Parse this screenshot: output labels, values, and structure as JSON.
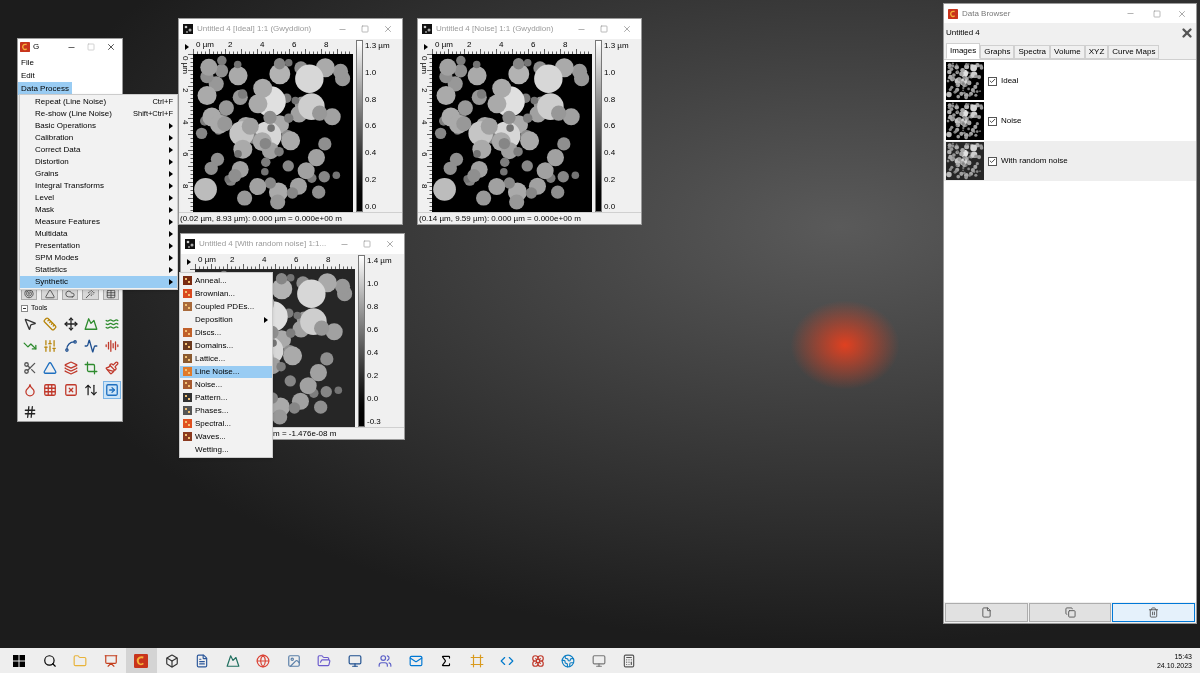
{
  "main_window": {
    "title": "G",
    "menu": [
      {
        "label": "File",
        "selected": false
      },
      {
        "label": "Edit",
        "selected": false
      },
      {
        "label": "Data Process",
        "selected": true
      }
    ],
    "toolbox_section": "Tools",
    "tools": [
      {
        "selected": false
      },
      {
        "selected": false
      },
      {
        "selected": false
      },
      {
        "selected": false
      },
      {
        "selected": false
      },
      {
        "selected": false
      },
      {
        "selected": false
      },
      {
        "selected": false
      },
      {
        "selected": false
      },
      {
        "selected": false
      },
      {
        "selected": false
      },
      {
        "selected": false
      },
      {
        "selected": false
      },
      {
        "selected": false
      },
      {
        "selected": false
      },
      {
        "selected": false
      },
      {
        "selected": false
      },
      {
        "selected": false
      },
      {
        "selected": false
      },
      {
        "selected": true
      },
      {
        "selected": false
      }
    ]
  },
  "data_process_menu": [
    {
      "label": "Repeat (Line Noise)",
      "shortcut": "Ctrl+F",
      "submenu": false,
      "selected": false
    },
    {
      "label": "Re-show (Line Noise)",
      "shortcut": "Shift+Ctrl+F",
      "submenu": false,
      "selected": false
    },
    {
      "label": "Basic Operations",
      "submenu": true,
      "selected": false
    },
    {
      "label": "Calibration",
      "submenu": true,
      "selected": false
    },
    {
      "label": "Correct Data",
      "submenu": true,
      "selected": false
    },
    {
      "label": "Distortion",
      "submenu": true,
      "selected": false
    },
    {
      "label": "Grains",
      "submenu": true,
      "selected": false
    },
    {
      "label": "Integral Transforms",
      "submenu": true,
      "selected": false
    },
    {
      "label": "Level",
      "submenu": true,
      "selected": false
    },
    {
      "label": "Mask",
      "submenu": true,
      "selected": false
    },
    {
      "label": "Measure Features",
      "submenu": true,
      "selected": false
    },
    {
      "label": "Multidata",
      "submenu": true,
      "selected": false
    },
    {
      "label": "Presentation",
      "submenu": true,
      "selected": false
    },
    {
      "label": "SPM Modes",
      "submenu": true,
      "selected": false
    },
    {
      "label": "Statistics",
      "submenu": true,
      "selected": false
    },
    {
      "label": "Synthetic",
      "submenu": true,
      "selected": true
    }
  ],
  "synthetic_menu": [
    {
      "label": "Anneal...",
      "submenu": false,
      "selected": false
    },
    {
      "label": "Brownian...",
      "submenu": false,
      "selected": false
    },
    {
      "label": "Coupled PDEs...",
      "submenu": false,
      "selected": false
    },
    {
      "label": "Deposition",
      "submenu": true,
      "selected": false
    },
    {
      "label": "Discs...",
      "submenu": false,
      "selected": false
    },
    {
      "label": "Domains...",
      "submenu": false,
      "selected": false
    },
    {
      "label": "Lattice...",
      "submenu": false,
      "selected": false
    },
    {
      "label": "Line Noise...",
      "submenu": false,
      "selected": true
    },
    {
      "label": "Noise...",
      "submenu": false,
      "selected": false
    },
    {
      "label": "Pattern...",
      "submenu": false,
      "selected": false
    },
    {
      "label": "Phases...",
      "submenu": false,
      "selected": false
    },
    {
      "label": "Spectral...",
      "submenu": false,
      "selected": false
    },
    {
      "label": "Waves...",
      "submenu": false,
      "selected": false
    },
    {
      "label": "Wetting...",
      "submenu": false,
      "selected": false
    }
  ],
  "image_windows": [
    {
      "title": "Untitled 4 [Ideal] 1:1 (Gwyddion)",
      "top_ruler": [
        "0 µm",
        "2",
        "4",
        "6",
        "8"
      ],
      "left_ruler": [
        "0 µm",
        "2",
        "4",
        "6",
        "8"
      ],
      "scale": [
        "1.3 µm",
        "1.0",
        "0.8",
        "0.6",
        "0.4",
        "0.2",
        "0.0"
      ],
      "status": "(0.02 µm, 8.93 µm): 0.000 µm = 0.000e+00 m",
      "noisy": false
    },
    {
      "title": "Untitled 4 [Noise] 1:1 (Gwyddion)",
      "top_ruler": [
        "0 µm",
        "2",
        "4",
        "6",
        "8"
      ],
      "left_ruler": [
        "0 µm",
        "2",
        "4",
        "6",
        "8"
      ],
      "scale": [
        "1.3 µm",
        "1.0",
        "0.8",
        "0.6",
        "0.4",
        "0.2",
        "0.0"
      ],
      "status": "(0.14 µm, 9.59 µm): 0.000 µm = 0.000e+00 m",
      "noisy": false
    },
    {
      "title": "Untitled 4 [With random noise] 1:1...",
      "top_ruler": [
        "0 µm",
        "2",
        "4",
        "6",
        "8"
      ],
      "scale": [
        "1.4 µm",
        "1.0",
        "0.8",
        "0.6",
        "0.4",
        "0.2",
        "0.0",
        "-0.3"
      ],
      "status": "m = -1.476e-08 m",
      "noisy": true
    }
  ],
  "data_browser": {
    "title": "Data Browser",
    "file": "Untitled 4",
    "tabs": [
      {
        "label": "Images",
        "selected": true
      },
      {
        "label": "Graphs",
        "selected": false
      },
      {
        "label": "Spectra",
        "selected": false
      },
      {
        "label": "Volume",
        "selected": false
      },
      {
        "label": "XYZ",
        "selected": false
      },
      {
        "label": "Curve Maps",
        "selected": false
      }
    ],
    "items": [
      {
        "label": "Ideal",
        "checked": true,
        "selected": false,
        "noisy": false
      },
      {
        "label": "Noise",
        "checked": true,
        "selected": false,
        "noisy": false
      },
      {
        "label": "With random noise",
        "checked": true,
        "selected": true,
        "noisy": true
      }
    ]
  },
  "taskbar": {
    "apps": [
      {
        "selected": false
      },
      {
        "selected": false
      },
      {
        "selected": false
      },
      {
        "selected": false
      },
      {
        "selected": true
      },
      {
        "selected": false
      },
      {
        "selected": false
      },
      {
        "selected": false
      },
      {
        "selected": false
      },
      {
        "selected": false
      },
      {
        "selected": false
      },
      {
        "selected": false
      },
      {
        "selected": false
      },
      {
        "selected": false
      },
      {
        "selected": false
      },
      {
        "selected": false
      },
      {
        "selected": false
      },
      {
        "selected": false
      },
      {
        "selected": false
      },
      {
        "selected": false
      },
      {
        "selected": false
      }
    ],
    "time": "15:43",
    "date": "24.10.2023"
  }
}
